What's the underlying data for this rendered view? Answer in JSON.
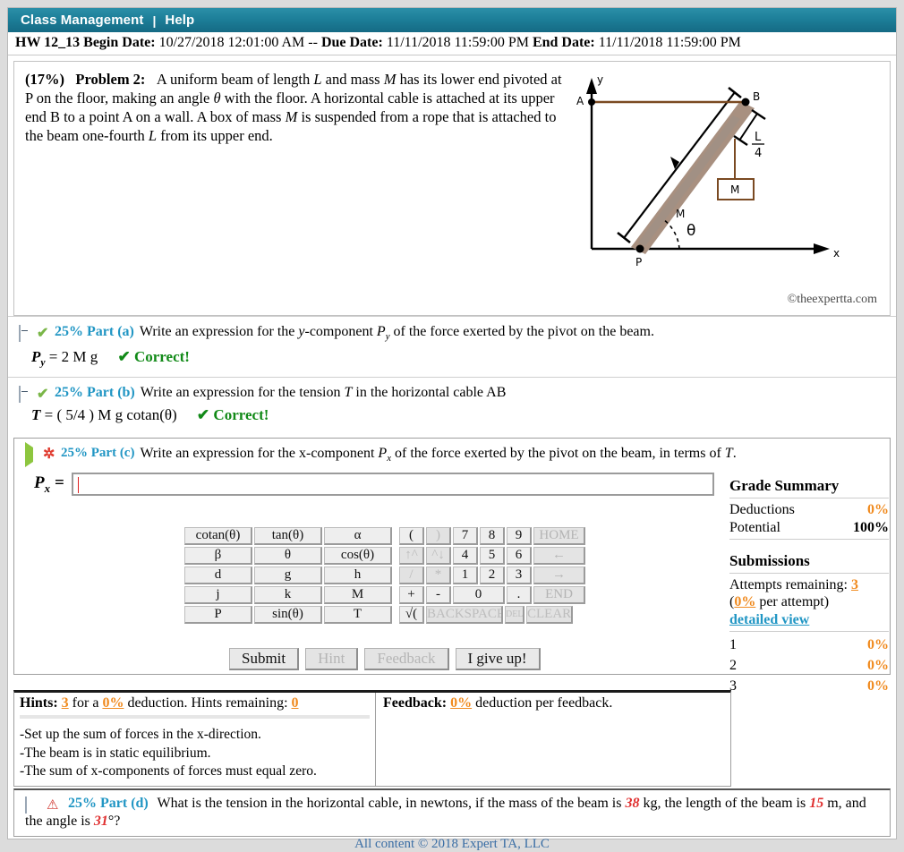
{
  "topbar": {
    "class_management": "Class Management",
    "separator": "|",
    "help": "Help"
  },
  "assignment": {
    "name": "HW 12_13",
    "begin_label": "Begin Date:",
    "begin_value": "10/27/2018 12:01:00 AM",
    "dash": "--",
    "due_label": "Due Date:",
    "due_value": "11/11/2018 11:59:00 PM",
    "end_label": "End Date:",
    "end_value": "11/11/2018 11:59:00 PM"
  },
  "problem": {
    "percent": "(17%)",
    "title": "Problem 2:",
    "text_1": "A uniform beam of length ",
    "var_L": "L",
    "text_2": " and mass ",
    "var_M": "M",
    "text_3": " has its lower end pivoted at P on the floor, making an angle ",
    "var_theta": "θ",
    "text_4": " with the floor. A horizontal cable is attached at its upper end B to a point A on a wall. A box of mass ",
    "var_M2": "M",
    "text_5": " is suspended from a rope that is attached to the beam one-fourth ",
    "var_L2": "L",
    "text_6": " from its upper end.",
    "copyright": "©theexpertta.com",
    "figure": {
      "axis_y": "y",
      "axis_x": "x",
      "point_A": "A",
      "point_B": "B",
      "point_P": "P",
      "beam_label": "M",
      "box_label": "M",
      "angle_label": "θ",
      "length_num": "L",
      "length_den": "4",
      "beam_color": "#a89080",
      "cable_color": "#7a4a22"
    }
  },
  "parts": [
    {
      "id": "a",
      "percent": "25%",
      "label": "Part (a)",
      "prompt_1": "Write an expression for the ",
      "prompt_var": "y",
      "prompt_2": "-component ",
      "sym": "P",
      "sym_sub": "y",
      "prompt_3": " of the force exerted by the pivot on the beam.",
      "answer": "P",
      "answer_sub": "y",
      "answer_rest": "= 2 M g",
      "status": "Correct!",
      "status_mark": "✔",
      "icon": "minus-box-icon",
      "state_icon": "green-check-icon"
    },
    {
      "id": "b",
      "percent": "25%",
      "label": "Part (b)",
      "prompt_1": "Write an expression for the tension ",
      "prompt_var": "T",
      "prompt_2": " in the horizontal cable AB",
      "answer": "T",
      "answer_rest": "= ( 5/4 ) M g cotan(θ)",
      "status": "Correct!",
      "status_mark": "✔",
      "icon": "minus-box-icon",
      "state_icon": "green-check-icon"
    }
  ],
  "active_part": {
    "percent": "25%",
    "label": "Part (c)",
    "prompt_1": "Write an expression for the x-component ",
    "sym": "P",
    "sym_sub": "x",
    "prompt_2": " of the force exerted by the pivot on the beam, in terms of ",
    "prompt_var": "T",
    "prompt_3": ".",
    "answer_label": "P",
    "answer_label_sub": "x",
    "answer_eq": "=",
    "answer_value": "",
    "icon": "green-triangle-icon",
    "state_icon": "red-asterisk-icon"
  },
  "keypad": {
    "rows": [
      [
        "cotan(θ)",
        "tan(θ)",
        "α",
        "(",
        ")",
        "7",
        "8",
        "9",
        "HOME"
      ],
      [
        "β",
        "θ",
        "cos(θ)",
        "↑^",
        "^↓",
        "4",
        "5",
        "6",
        "←"
      ],
      [
        "d",
        "g",
        "h",
        "/",
        "*",
        "1",
        "2",
        "3",
        "→"
      ],
      [
        "j",
        "k",
        "M",
        "+",
        "-",
        "0",
        ".",
        "END"
      ],
      [
        "P",
        "sin(θ)",
        "T",
        "√(",
        "BACKSPACE",
        "DEL",
        "CLEAR"
      ]
    ]
  },
  "actions": {
    "submit": "Submit",
    "hint": "Hint",
    "feedback": "Feedback",
    "give_up": "I give up!"
  },
  "grade_summary": {
    "title": "Grade Summary",
    "deductions_label": "Deductions",
    "deductions_value": "0%",
    "potential_label": "Potential",
    "potential_value": "100%",
    "submissions_title": "Submissions",
    "attempts_label": "Attempts remaining:",
    "attempts_value": "3",
    "per_attempt_open": "(",
    "per_attempt_value": "0%",
    "per_attempt_text": " per attempt)",
    "detailed_view": "detailed view",
    "rows": [
      {
        "n": "1",
        "v": "0%"
      },
      {
        "n": "2",
        "v": "0%"
      },
      {
        "n": "3",
        "v": "0%"
      }
    ]
  },
  "hints": {
    "title": "Hints:",
    "count": "3",
    "for_a": "for a",
    "deduction_pct": "0%",
    "deduction_text": "deduction. Hints remaining:",
    "remaining": "0",
    "items": [
      "-Set up the sum of forces in the x-direction.",
      "-The beam is in static equilibrium.",
      "-The sum of x-components of forces must equal zero."
    ]
  },
  "feedback": {
    "title": "Feedback:",
    "pct": "0%",
    "text": "deduction per feedback."
  },
  "part_d": {
    "percent": "25%",
    "label": "Part (d)",
    "text_1": "What is the tension in the horizontal cable, in newtons, if the mass of the beam is ",
    "mass": "38",
    "text_2": " kg, the length of the beam is ",
    "length": "15",
    "text_3": " m, and the angle is ",
    "angle": "31",
    "text_4": "°?",
    "icon": "plus-box-icon",
    "state_icon": "red-warning-icon"
  },
  "footer": "All content © 2018 Expert TA, LLC",
  "colors": {
    "teal": "#1d7f99",
    "accent_blue": "#2196c4",
    "orange": "#f08a1e",
    "green": "#128a18",
    "red": "#e03030"
  }
}
